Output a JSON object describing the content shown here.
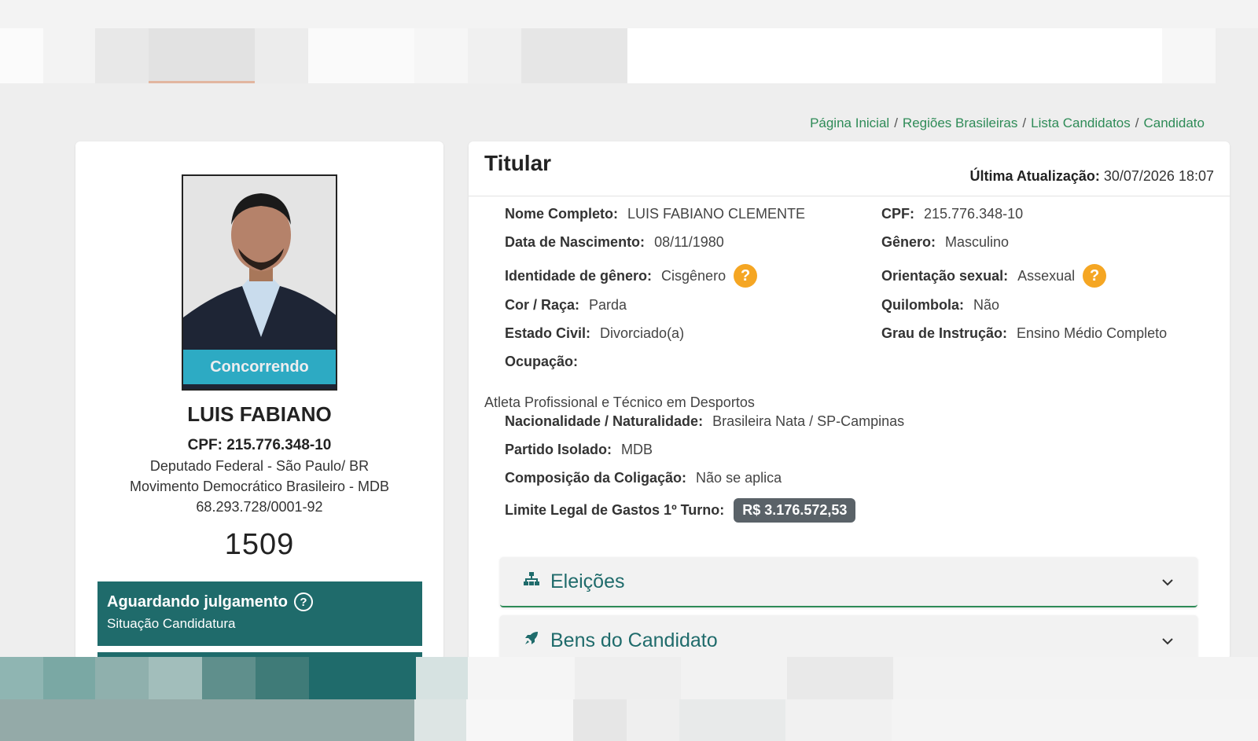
{
  "breadcrumb": {
    "items": [
      "Página Inicial",
      "Regiões Brasileiras",
      "Lista Candidatos",
      "Candidato"
    ],
    "separator": "/"
  },
  "candidate": {
    "photo_badge": "Concorrendo",
    "name": "LUIS FABIANO",
    "cpf_line": "CPF: 215.776.348-10",
    "office_line": "Deputado Federal - São Paulo/ BR",
    "party_line": "Movimento Democrático Brasileiro - MDB",
    "cnpj_line": "68.293.728/0001-92",
    "number": "1509",
    "status_title": "Aguardando julgamento",
    "status_subtitle": "Situação Candidatura"
  },
  "details": {
    "title": "Titular",
    "updated_label": "Última Atualização:",
    "updated_value": "30/07/2026 18:07",
    "fields": {
      "nome_label": "Nome Completo:",
      "nome_value": "LUIS FABIANO CLEMENTE",
      "cpf_label": "CPF:",
      "cpf_value": "215.776.348-10",
      "nascimento_label": "Data de Nascimento:",
      "nascimento_value": "08/11/1980",
      "genero_label": "Gênero:",
      "genero_value": "Masculino",
      "identidade_label": "Identidade de gênero:",
      "identidade_value": "Cisgênero",
      "orientacao_label": "Orientação sexual:",
      "orientacao_value": "Assexual",
      "cor_label": "Cor / Raça:",
      "cor_value": "Parda",
      "quilombola_label": "Quilombola:",
      "quilombola_value": "Não",
      "estado_civil_label": "Estado Civil:",
      "estado_civil_value": "Divorciado(a)",
      "instrucao_label": "Grau de Instrução:",
      "instrucao_value": "Ensino Médio Completo",
      "ocupacao_label": "Ocupação:",
      "ocupacao_value": "Atleta Profissional e Técnico em Desportos",
      "nacionalidade_label": "Nacionalidade / Naturalidade:",
      "nacionalidade_value": "Brasileira Nata / SP-Campinas",
      "partido_label": "Partido Isolado:",
      "partido_value": "MDB",
      "coligacao_label": "Composição da Coligação:",
      "coligacao_value": "Não se aplica",
      "limite_label": "Limite Legal de Gastos 1º Turno:",
      "limite_value": "R$ 3.176.572,53"
    },
    "help_glyph": "?"
  },
  "accordions": [
    {
      "label": "Eleições",
      "icon": "sitemap-icon"
    },
    {
      "label": "Bens do Candidato",
      "icon": "rocket-icon"
    }
  ],
  "colors": {
    "accent_green": "#2e8b57",
    "teal_dark": "#1f6b6b",
    "badge_cyan": "#2fb6d0",
    "help_orange": "#f5a623",
    "money_gray": "#5a6268"
  }
}
